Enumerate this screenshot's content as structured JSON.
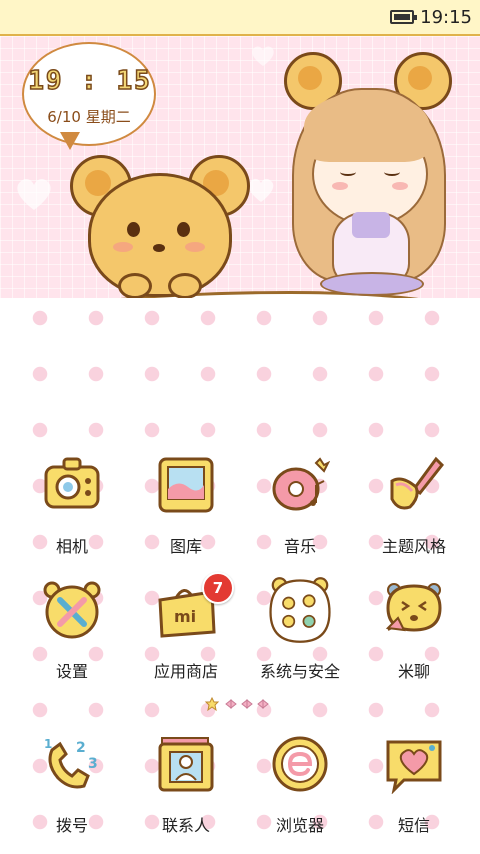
{
  "status_bar": {
    "time": "19:15",
    "battery_icon": "battery-icon"
  },
  "widget": {
    "clock_time": "19 : 15",
    "date": "6/10  星期二"
  },
  "apps_row1": [
    {
      "label": "相机",
      "icon": "camera-icon"
    },
    {
      "label": "图库",
      "icon": "gallery-icon"
    },
    {
      "label": "音乐",
      "icon": "music-icon"
    },
    {
      "label": "主题风格",
      "icon": "theme-icon"
    }
  ],
  "apps_row2": [
    {
      "label": "设置",
      "icon": "settings-icon"
    },
    {
      "label": "应用商店",
      "icon": "app-store-icon",
      "badge": "7"
    },
    {
      "label": "系统与安全",
      "icon": "system-security-icon"
    },
    {
      "label": "米聊",
      "icon": "michat-icon"
    }
  ],
  "dock": [
    {
      "label": "拨号",
      "icon": "phone-icon"
    },
    {
      "label": "联系人",
      "icon": "contacts-icon"
    },
    {
      "label": "浏览器",
      "icon": "browser-icon"
    },
    {
      "label": "短信",
      "icon": "sms-icon"
    }
  ],
  "pager": {
    "pages": 4,
    "current": 1
  },
  "colors": {
    "icon_yellow": "#f8dc6a",
    "icon_outline": "#7a4a1a",
    "badge_red": "#e33a32",
    "dot_pink": "#f9d2de"
  }
}
